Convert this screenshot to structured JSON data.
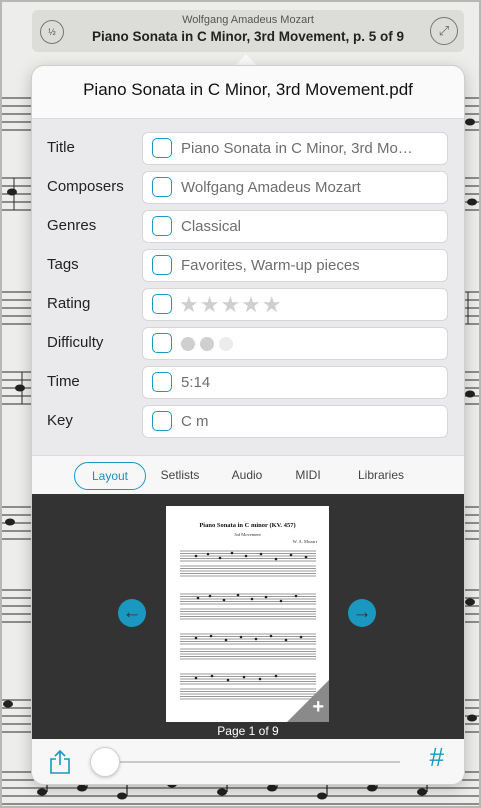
{
  "topbar": {
    "composer": "Wolfgang Amadeus Mozart",
    "title": "Piano Sonata in C Minor, 3rd Movement, p. 5 of 9",
    "half_label": "½"
  },
  "popover": {
    "title": "Piano Sonata in C Minor, 3rd Movement.pdf"
  },
  "fields": [
    {
      "label": "Title",
      "value": "Piano Sonata in C Minor, 3rd Mo…"
    },
    {
      "label": "Composers",
      "value": "Wolfgang Amadeus Mozart"
    },
    {
      "label": "Genres",
      "value": "Classical"
    },
    {
      "label": "Tags",
      "value": "Favorites, Warm-up pieces"
    },
    {
      "label": "Rating",
      "stars": "★★★★★"
    },
    {
      "label": "Difficulty"
    },
    {
      "label": "Time",
      "value": "5:14"
    },
    {
      "label": "Key",
      "value": "C m"
    }
  ],
  "tabs": [
    "Layout",
    "Setlists",
    "Audio",
    "MIDI",
    "Libraries"
  ],
  "preview": {
    "score_title": "Piano Sonata in C minor (KV. 457)",
    "score_subtitle": "3rd Movement",
    "score_composer": "W. A. Mozart",
    "page_label": "Page 1 of 9",
    "plus": "+",
    "prev": "←",
    "next": "→"
  },
  "bottom": {
    "hash": "#"
  },
  "colors": {
    "accent": "#1a98c0",
    "dark_panel": "#333333"
  }
}
